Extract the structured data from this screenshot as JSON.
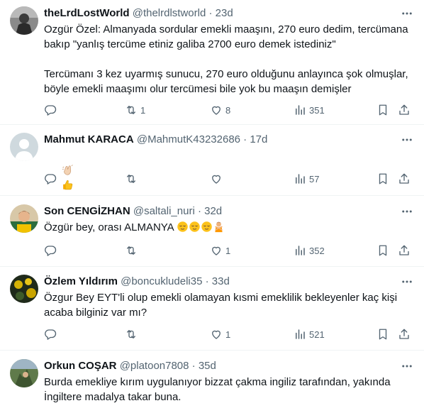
{
  "tweets": [
    {
      "name": "theLrdLostWorld",
      "handle": "@thelrdlstworld",
      "sep": "·",
      "time": "23d",
      "text": "Ozgür Özel: Almanyada sordular emekli maaşını, 270 euro dedim, tercümana bakıp \"yanlış tercüme etiniz galiba 2700 euro demek istediniz\"\n\nTercümanı 3 kez uyarmış sunucu, 270 euro olduğunu anlayınca şok olmuşlar, böyle emekli maaşımı olur tercümesi bile yok bu maaşın demişler",
      "replies": "",
      "retweets": "1",
      "likes": "8",
      "views": "351"
    },
    {
      "name": "Mahmut KARACA",
      "handle": "@MahmutK43232686",
      "sep": "·",
      "time": "17d",
      "emoji": [
        "clapping-hands-light-skin",
        "thumbs-up"
      ],
      "replies": "",
      "retweets": "",
      "likes": "",
      "views": "57"
    },
    {
      "name": "Son CENGİZHAN",
      "handle": "@saltali_nuri",
      "sep": "·",
      "time": "32d",
      "text": "Özgür bey, orası ALMANYA",
      "emoji": [
        "relieved-face",
        "relieved-face",
        "relieved-face",
        "person-gesturing-no"
      ],
      "replies": "",
      "retweets": "",
      "likes": "1",
      "views": "352"
    },
    {
      "name": "Özlem Yıldırım",
      "handle": "@boncukludeli35",
      "sep": "·",
      "time": "33d",
      "text": "Özgur Bey EYT'li olup emekli olamayan kısmi emeklilik bekleyenler kaç kişi acaba bilginiz var mı?",
      "replies": "",
      "retweets": "",
      "likes": "1",
      "views": "521"
    },
    {
      "name": "Orkun COŞAR",
      "handle": "@platoon7808",
      "sep": "·",
      "time": "35d",
      "text": "Burda emekliye kırım uygulanıyor bizzat çakma ingiliz tarafından, yakında İngiltere madalya takar buna."
    }
  ],
  "colors": {
    "text": "#0f1419",
    "secondary": "#536471",
    "border": "#eff3f4"
  }
}
